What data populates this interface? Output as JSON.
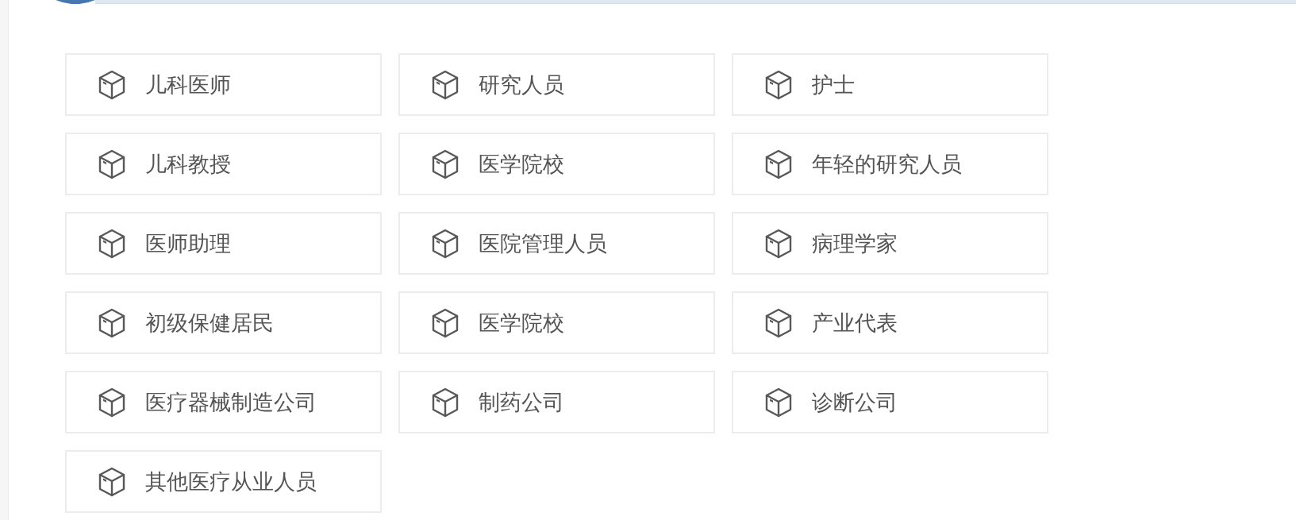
{
  "roles": [
    "儿科医师",
    "研究人员",
    "护士",
    "儿科教授",
    "医学院校",
    "年轻的研究人员",
    "医师助理",
    "医院管理人员",
    "病理学家",
    "初级保健居民",
    "医学院校",
    "产业代表",
    "医疗器械制造公司",
    "制药公司",
    "诊断公司",
    "其他医疗从业人员"
  ]
}
